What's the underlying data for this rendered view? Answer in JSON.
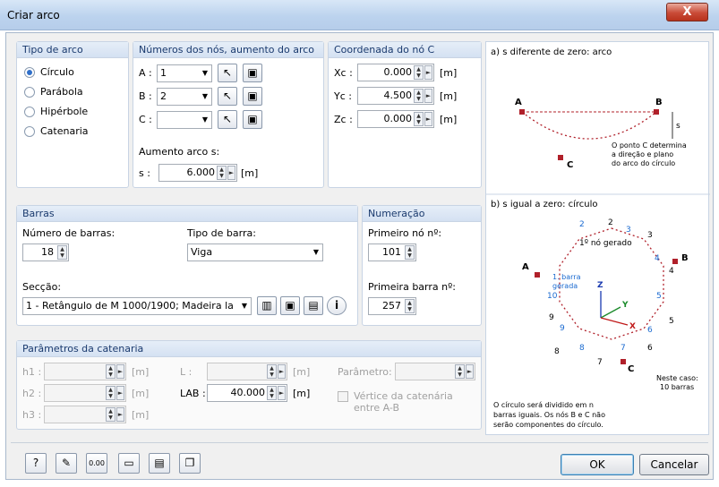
{
  "window": {
    "title": "Criar arco",
    "close_glyph": "X"
  },
  "tipo_arco": {
    "header": "Tipo de arco",
    "options": [
      {
        "label": "Círculo",
        "selected": true
      },
      {
        "label": "Parábola",
        "selected": false
      },
      {
        "label": "Hipérbole",
        "selected": false
      },
      {
        "label": "Catenaria",
        "selected": false
      }
    ]
  },
  "numeros_nos": {
    "header": "Números dos nós, aumento do arco",
    "a_label": "A :",
    "a_value": "1",
    "b_label": "B :",
    "b_value": "2",
    "c_label": "C :",
    "c_value": "",
    "aumento_label": "Aumento arco s:",
    "s_label": "s :",
    "s_value": "6.000",
    "s_unit": "[m]"
  },
  "coordenada": {
    "header": "Coordenada do nó C",
    "xc_label": "Xc :",
    "xc_value": "0.000",
    "xc_unit": "[m]",
    "yc_label": "Yc :",
    "yc_value": "4.500",
    "yc_unit": "[m]",
    "zc_label": "Zc :",
    "zc_value": "0.000",
    "zc_unit": "[m]"
  },
  "barras": {
    "header": "Barras",
    "num_label": "Número de barras:",
    "num_value": "18",
    "tipo_label": "Tipo de barra:",
    "tipo_value": "Viga",
    "seccao_label": "Secção:",
    "seccao_value": "1 - Retângulo de M 1000/1900; Madeira la"
  },
  "numeracao": {
    "header": "Numeração",
    "no_label": "Primeiro nó nº:",
    "no_value": "101",
    "barra_label": "Primeira barra nº:",
    "barra_value": "257"
  },
  "catenaria": {
    "header": "Parâmetros da catenaria",
    "h1_label": "h1 :",
    "h2_label": "h2 :",
    "h3_label": "h3 :",
    "unit": "[m]",
    "l_label": "L :",
    "lab_label": "LAB :",
    "lab_value": "40.000",
    "param_label": "Parâmetro:",
    "vertice_label": "Vértice da catenária entre A-B"
  },
  "figure": {
    "a_title": "a) s diferente de zero: arco",
    "a_note": "O ponto C determina a direção e plano do arco do círculo",
    "b_title": "b) s igual a zero: círculo",
    "first_node": "1º nó gerado",
    "first_bar": "1. barra gerada",
    "caso": "Neste caso: 10 barras",
    "bottom_note": "O círculo será dividido em n barras iguais. Os nós B e C não serão componentes do círculo."
  },
  "buttons": {
    "ok": "OK",
    "cancel": "Cancelar"
  },
  "icons": [
    "help-icon",
    "edit-icon",
    "units-icon",
    "open-icon",
    "save-icon",
    "copy-icon"
  ],
  "colors": {
    "node": "#b0202a",
    "header_text": "#1a3a6e",
    "axis_z": "#1a3ab0",
    "axis_y": "#1a8a2a",
    "axis_x": "#c01818",
    "circle_label": "#1a6ad0"
  }
}
